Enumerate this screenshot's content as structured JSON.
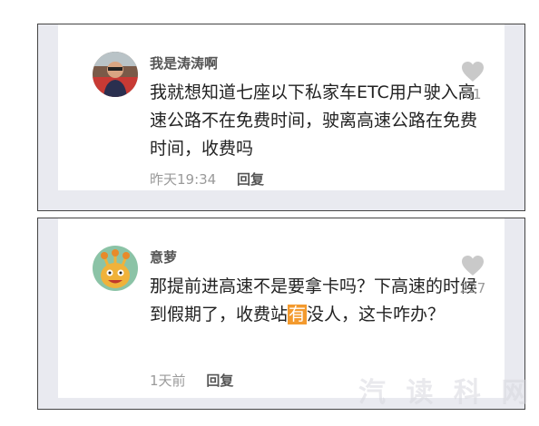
{
  "comments": [
    {
      "username": "我是涛涛啊",
      "text": "我就想知道七座以下私家车ETC用户驶入高速公路不在免费时间，驶离高速公路在免费时间，收费吗",
      "time": "昨天19:34",
      "reply_label": "回复",
      "like_count": "61",
      "avatar_icon": "user-photo-avatar-icon",
      "like_icon": "heart-icon"
    },
    {
      "username": "意萝",
      "text_before": "那提前进高速不是要拿卡吗？下高速的时候到假期了，收费站",
      "text_highlight": "有",
      "text_after": "没人，这卡咋办？",
      "time": "1天前",
      "reply_label": "回复",
      "like_count": "227",
      "avatar_icon": "cartoon-monster-avatar-icon",
      "like_icon": "heart-icon"
    }
  ],
  "watermark": "汽 读 科 网"
}
